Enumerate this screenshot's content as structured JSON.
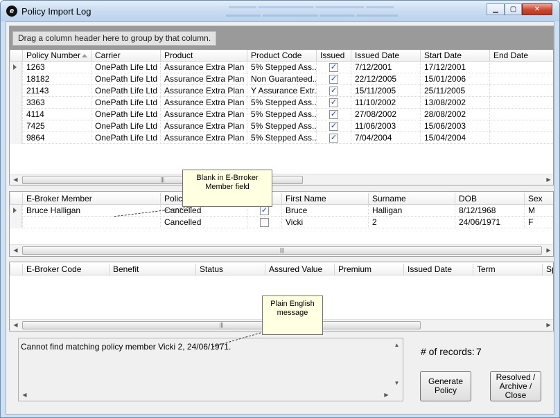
{
  "window": {
    "title": "Policy Import Log"
  },
  "group_hint": "Drag a column header here to group by that column.",
  "policies": {
    "columns": [
      "Policy Number",
      "Carrier",
      "Product",
      "Product Code",
      "Issued",
      "Issued Date",
      "Start Date",
      "End Date"
    ],
    "rows": [
      {
        "policy_number": "1263",
        "carrier": "OnePath Life Ltd",
        "product": "Assurance Extra Plan",
        "product_code": "5% Stepped Ass...",
        "issued": true,
        "issued_date": "7/12/2001",
        "start_date": "17/12/2001",
        "end_date": ""
      },
      {
        "policy_number": "18182",
        "carrier": "OnePath Life Ltd",
        "product": "Assurance Extra Plan ...",
        "product_code": "Non Guaranteed...",
        "issued": true,
        "issued_date": "22/12/2005",
        "start_date": "15/01/2006",
        "end_date": ""
      },
      {
        "policy_number": "21143",
        "carrier": "OnePath Life Ltd",
        "product": "Assurance Extra Plan",
        "product_code": "Y Assurance Extr...",
        "issued": true,
        "issued_date": "15/11/2005",
        "start_date": "25/11/2005",
        "end_date": ""
      },
      {
        "policy_number": "3363",
        "carrier": "OnePath Life Ltd",
        "product": "Assurance Extra Plan",
        "product_code": "5% Stepped Ass...",
        "issued": true,
        "issued_date": "11/10/2002",
        "start_date": "13/08/2002",
        "end_date": ""
      },
      {
        "policy_number": "4114",
        "carrier": "OnePath Life Ltd",
        "product": "Assurance Extra Plan",
        "product_code": "5% Stepped Ass...",
        "issued": true,
        "issued_date": "27/08/2002",
        "start_date": "28/08/2002",
        "end_date": ""
      },
      {
        "policy_number": "7425",
        "carrier": "OnePath Life Ltd",
        "product": "Assurance Extra Plan",
        "product_code": "5% Stepped Ass...",
        "issued": true,
        "issued_date": "11/06/2003",
        "start_date": "15/06/2003",
        "end_date": ""
      },
      {
        "policy_number": "9864",
        "carrier": "OnePath Life Ltd",
        "product": "Assurance Extra Plan",
        "product_code": "5% Stepped Ass...",
        "issued": true,
        "issued_date": "7/04/2004",
        "start_date": "15/04/2004",
        "end_date": ""
      }
    ]
  },
  "members": {
    "columns": [
      "E-Broker Member",
      "Policy",
      "y",
      "First Name",
      "Surname",
      "DOB",
      "Sex"
    ],
    "rows": [
      {
        "member": "Bruce Halligan",
        "policy": "Cancelled",
        "checked": true,
        "first_name": "Bruce",
        "surname": "Halligan",
        "dob": "8/12/1968",
        "sex": "M"
      },
      {
        "member": "",
        "policy": "Cancelled",
        "checked": false,
        "first_name": "Vicki",
        "surname": "2",
        "dob": "24/06/1971",
        "sex": "F"
      }
    ]
  },
  "benefits": {
    "columns": [
      "E-Broker Code",
      "Benefit",
      "Status",
      "Assured Value",
      "Premium",
      "Issued Date",
      "Term",
      "Sp"
    ]
  },
  "callouts": {
    "blank_member": "Blank in E-Brroker Member field",
    "plain_english": "Plain English message"
  },
  "message": "Cannot find matching policy member Vicki 2, 24/06/1971.",
  "records": {
    "label": "# of records:",
    "value": "7"
  },
  "buttons": {
    "generate": "Generate Policy",
    "resolved": "Resolved / Archive / Close"
  }
}
